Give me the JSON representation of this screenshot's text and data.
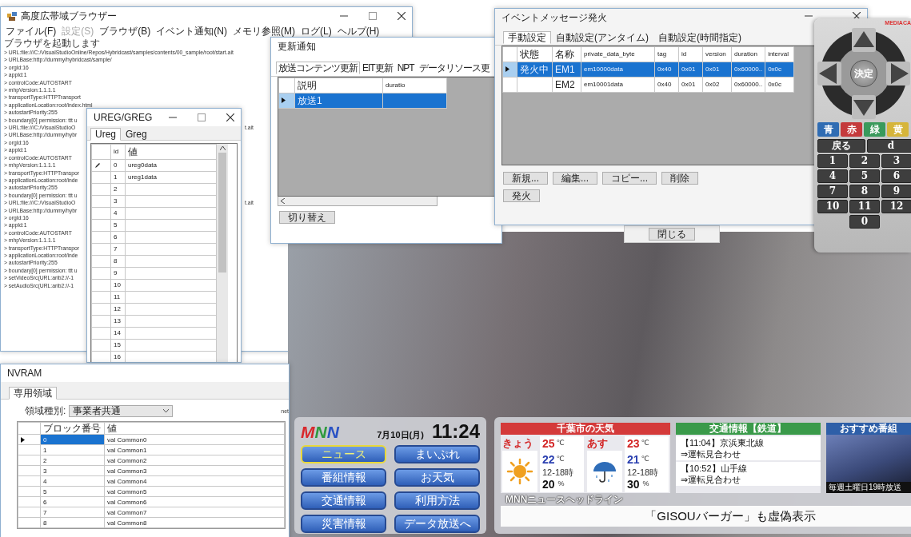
{
  "main_window": {
    "title": "高度広帯域ブラウザー",
    "menu": [
      {
        "label": "ファイル(F)",
        "disabled": false
      },
      {
        "label": "設定(S)",
        "disabled": true
      },
      {
        "label": "ブラウザ(B)",
        "disabled": false
      },
      {
        "label": "イベント通知(N)",
        "disabled": false
      },
      {
        "label": "メモリ参照(M)",
        "disabled": false
      },
      {
        "label": "ログ(L)",
        "disabled": false
      },
      {
        "label": "ヘルプ(H)",
        "disabled": false
      }
    ],
    "log": [
      {
        "text": "ブラウザを起動します"
      },
      {
        "text": "> URL:file:///C:/VisualStudioOnline/Repos/Hybridcast/samples/contents/00_sample/root/start.ait"
      },
      {
        "text": "> URLBase:http://dummy/hybridcast/sample/"
      },
      {
        "text": "> orgId:16"
      },
      {
        "text": "> appId:1"
      },
      {
        "text": "> controlCode:AUTOSTART"
      },
      {
        "text": "> mhpVersion:1.1.1.1"
      },
      {
        "text": "> transportType:HTTPTransport"
      },
      {
        "text": "> applicationLocation:root/index.html"
      },
      {
        "text": "> autostartPriority:255"
      },
      {
        "text": "> boundary[0] permission: ttt u"
      },
      {
        "text": "> URL:file:///C:/VisualStudioO",
        "tail": "t.ait"
      },
      {
        "text": "> URLBase:http://dummy/hybr"
      },
      {
        "text": "> orgId:16"
      },
      {
        "text": "> appId:1"
      },
      {
        "text": "> controlCode:AUTOSTART"
      },
      {
        "text": "> mhpVersion:1.1.1.1"
      },
      {
        "text": "> transportType:HTTPTranspor"
      },
      {
        "text": "> applicationLocation:root/inde"
      },
      {
        "text": "> autostartPriority:255"
      },
      {
        "text": "> boundary[0] permission: ttt u"
      },
      {
        "text": "> URL:file:///C:/VisualStudioO",
        "tail": "t.ait"
      },
      {
        "text": "> URLBase:http://dummy/hybr"
      },
      {
        "text": "> orgId:16"
      },
      {
        "text": "> appId:1"
      },
      {
        "text": "> controlCode:AUTOSTART"
      },
      {
        "text": "> mhpVersion:1.1.1.1"
      },
      {
        "text": "> transportType:HTTPTranspor"
      },
      {
        "text": "> applicationLocation:root/inde"
      },
      {
        "text": "> autostartPriority:255"
      },
      {
        "text": "> boundary[0] permission: ttt u"
      },
      {
        "text": "> setVideoSrc(URL:arib2://-1"
      },
      {
        "text": "> setAudioSrc(URL:arib2://-1"
      }
    ]
  },
  "ureg_window": {
    "title": "UREG/GREG",
    "tabs": [
      {
        "label": "Ureg",
        "selected": true
      },
      {
        "label": "Greg",
        "selected": false
      }
    ],
    "columns": [
      "id",
      "値"
    ],
    "rows": [
      {
        "id": "0",
        "value": "ureg0data",
        "editing": true
      },
      {
        "id": "1",
        "value": "ureg1data",
        "editing": false
      },
      {
        "id": "2",
        "editing": false
      },
      {
        "id": "3",
        "editing": false
      },
      {
        "id": "4",
        "editing": false
      },
      {
        "id": "5",
        "editing": false
      },
      {
        "id": "6",
        "editing": false
      },
      {
        "id": "7",
        "editing": false
      },
      {
        "id": "8",
        "editing": false
      },
      {
        "id": "9",
        "editing": false
      },
      {
        "id": "10",
        "editing": false
      },
      {
        "id": "11",
        "editing": false
      },
      {
        "id": "12",
        "editing": false
      },
      {
        "id": "13",
        "editing": false
      },
      {
        "id": "14",
        "editing": false
      },
      {
        "id": "15",
        "editing": false
      },
      {
        "id": "16",
        "editing": false
      }
    ]
  },
  "update_window": {
    "title": "更新通知",
    "tabs": [
      {
        "label": "放送コンテンツ更新",
        "selected": true
      },
      {
        "label": "EIT更新",
        "selected": false
      },
      {
        "label": "NPT",
        "selected": false
      },
      {
        "label": "データリソース更",
        "selected": false
      }
    ],
    "columns": [
      "説明",
      "duratio"
    ],
    "rows": [
      {
        "description": "放送1",
        "selected": true
      }
    ],
    "button": "切り替え"
  },
  "event_window": {
    "title": "イベントメッセージ発火",
    "tabs": [
      {
        "label": "手動設定",
        "selected": true
      },
      {
        "label": "自動設定(アンタイム)",
        "selected": false
      },
      {
        "label": "自動設定(時間指定)",
        "selected": false
      }
    ],
    "columns": [
      "状態",
      "名称",
      "private_data_byte",
      "tag",
      "id",
      "version",
      "duration",
      "interval"
    ],
    "rows": [
      {
        "status": "発火中",
        "name": "EM1",
        "data": "em10000data",
        "tag": "0x40",
        "id": "0x01",
        "version": "0x01",
        "duration": "0x60000..",
        "interval": "0x0c",
        "selected": true
      },
      {
        "name": "EM2",
        "data": "em10001data",
        "tag": "0x40",
        "id": "0x01",
        "version": "0x02",
        "duration": "0x60000..",
        "interval": "0x0c",
        "selected": false
      }
    ],
    "buttons": [
      "新規...",
      "編集...",
      "コピー...",
      "削除"
    ],
    "fire_button": "発火"
  },
  "close_button": "閉じる",
  "remote": {
    "brand": "MEDIACA",
    "ok_label": "決定",
    "color_keys": [
      {
        "label": "青",
        "color": "#2f6cb3"
      },
      {
        "label": "赤",
        "color": "#c43a3c"
      },
      {
        "label": "緑",
        "color": "#3a9a5c"
      },
      {
        "label": "黄",
        "color": "#d6b53a"
      }
    ],
    "back_label": "戻る",
    "d_label": "d",
    "number_keys": [
      "1",
      "2",
      "3",
      "4",
      "5",
      "6",
      "7",
      "8",
      "9",
      "10",
      "11",
      "12",
      "0"
    ]
  },
  "nvram_window": {
    "title": "NVRAM",
    "tabs": [
      {
        "label": "専用領域",
        "selected": true
      }
    ],
    "area_label": "領域種別:",
    "area_value": "事業者共通",
    "cut_label": "net",
    "columns": [
      "ブロック番号",
      "値"
    ],
    "rows": [
      {
        "block": "0",
        "value": "val Common0",
        "selected": true
      },
      {
        "block": "1",
        "value": "val Common1",
        "selected": false
      },
      {
        "block": "2",
        "value": "val Common2",
        "selected": false
      },
      {
        "block": "3",
        "value": "val Common3",
        "selected": false
      },
      {
        "block": "4",
        "value": "val Common4",
        "selected": false
      },
      {
        "block": "5",
        "value": "val Common5",
        "selected": false
      },
      {
        "block": "6",
        "value": "val Common6",
        "selected": false
      },
      {
        "block": "7",
        "value": "val Common7",
        "selected": false
      },
      {
        "block": "8",
        "value": "val Common8",
        "selected": false
      }
    ]
  },
  "broadcast": {
    "logo": [
      {
        "letter": "M",
        "color": "#d8282c"
      },
      {
        "letter": "N",
        "color": "#2e9a3e"
      },
      {
        "letter": "N",
        "color": "#2a52c4"
      }
    ],
    "date": "7月10日(月)",
    "time": "11:24",
    "menu": [
      {
        "label": "ニュース",
        "focused": true
      },
      {
        "label": "まいぷれ",
        "focused": false
      },
      {
        "label": "番組情報",
        "focused": false
      },
      {
        "label": "お天気",
        "focused": false
      },
      {
        "label": "交通情報",
        "focused": false
      },
      {
        "label": "利用方法",
        "focused": false
      },
      {
        "label": "災害情報",
        "focused": false
      },
      {
        "label": "データ放送へ",
        "focused": false
      }
    ],
    "weather": {
      "title": "千葉市の天気",
      "days": [
        {
          "label": "きょう",
          "kind": "sunny",
          "high": "25",
          "high_unit": "℃",
          "low": "22",
          "low_unit": "℃",
          "period": "12-18時",
          "rain": "20",
          "rain_unit": "%"
        },
        {
          "label": "あす",
          "kind": "rain",
          "high": "23",
          "high_unit": "℃",
          "low": "21",
          "low_unit": "℃",
          "period": "12-18時",
          "rain": "30",
          "rain_unit": "%"
        }
      ]
    },
    "traffic": {
      "title": "交通情報【鉄道】",
      "items": [
        {
          "line": "【11:04】京浜東北線",
          "status": "⇒運転見合わせ"
        },
        {
          "line": "【10:52】山手線",
          "status": "⇒運転見合わせ"
        }
      ]
    },
    "recommend": {
      "title": "おすすめ番組",
      "caption": "毎週土曜日19時放送"
    },
    "headline_label": "MNNニュースヘッドライン",
    "headline": "「GISOUバーガー」も虚偽表示"
  }
}
